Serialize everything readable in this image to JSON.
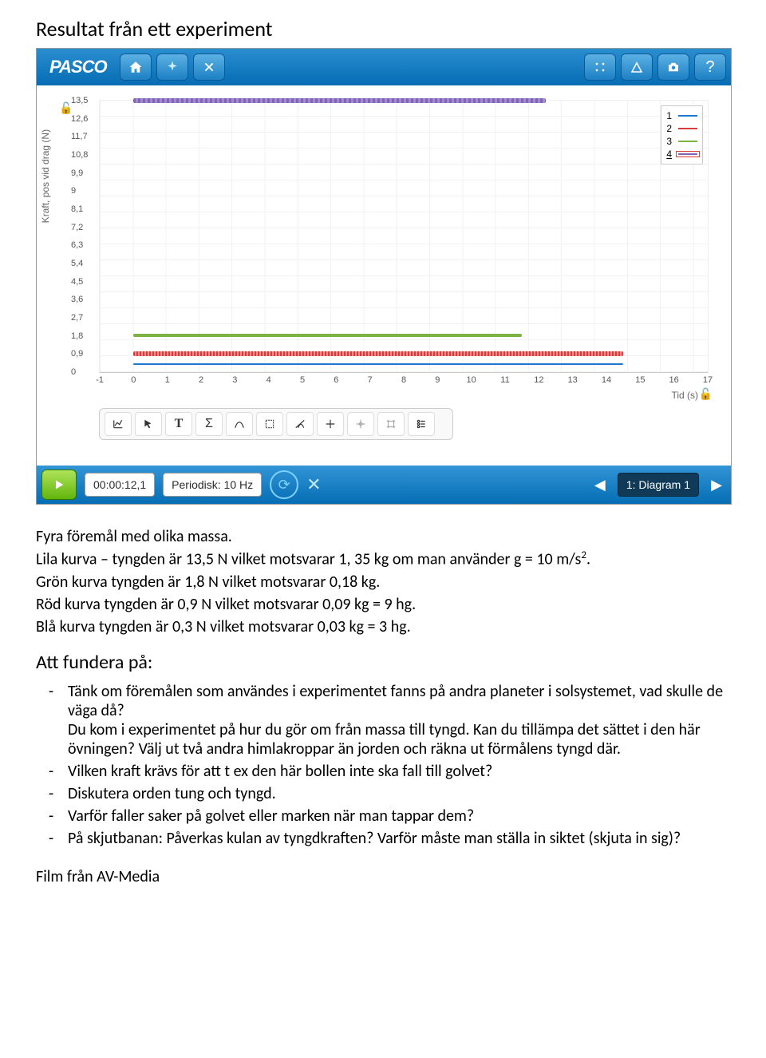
{
  "heading": "Resultat från ett experiment",
  "app": {
    "logo": "PASCO",
    "yaxis": "Kraft, pos vid drag (N)",
    "xaxis": "Tid (s)",
    "time": "00:00:12,1",
    "rate": "Periodisk: 10 Hz",
    "diagram": "1: Diagram 1",
    "legend": [
      "1",
      "2",
      "3",
      "4"
    ]
  },
  "chart_data": {
    "type": "line",
    "title": "",
    "xlabel": "Tid (s)",
    "ylabel": "Kraft, pos vid drag (N)",
    "xlim": [
      -1,
      17
    ],
    "ylim": [
      0,
      13.5
    ],
    "xticks": [
      -1,
      0,
      1,
      2,
      3,
      4,
      5,
      6,
      7,
      8,
      9,
      10,
      11,
      12,
      13,
      14,
      15,
      16,
      17
    ],
    "yticks": [
      0.0,
      0.9,
      1.8,
      2.7,
      3.6,
      4.5,
      5.4,
      6.3,
      7.2,
      8.1,
      9.0,
      9.9,
      10.8,
      11.7,
      12.6,
      13.5
    ],
    "series": [
      {
        "name": "1",
        "color": "blue",
        "yvalue": 0.3,
        "x_start": 0,
        "x_end": 14.5
      },
      {
        "name": "2",
        "color": "red",
        "yvalue": 0.9,
        "x_start": 0,
        "x_end": 14.5
      },
      {
        "name": "3",
        "color": "green",
        "yvalue": 1.8,
        "x_start": 0,
        "x_end": 11.5
      },
      {
        "name": "4",
        "color": "purple",
        "yvalue": 13.5,
        "x_start": 0,
        "x_end": 12.2
      }
    ]
  },
  "body": {
    "p1": "Fyra föremål med olika massa.",
    "p2a": "Lila kurva – tyngden är 13,5 N vilket motsvarar 1, 35 kg om man använder g = 10 m/s",
    "p2b_sup": "2",
    "p2c": ".",
    "p3": "Grön kurva tyngden är 1,8 N vilket motsvarar 0,18 kg.",
    "p4": "Röd kurva tyngden är 0,9 N vilket motsvarar 0,09 kg = 9 hg.",
    "p5": "Blå kurva tyngden är 0,3 N vilket motsvarar 0,03 kg = 3 hg.",
    "thinkTitle": "Att fundera på:",
    "q1a": "Tänk om föremålen som användes i experimentet fanns på andra planeter i solsystemet, vad skulle de väga då?",
    "q1b": "Du kom i experimentet på hur du gör om från massa till tyngd. Kan du tillämpa det sättet i den här övningen? Välj ut två andra himlakroppar än jorden och räkna ut förmålens tyngd där.",
    "q2": "Vilken kraft krävs för att t ex den här bollen inte ska fall till golvet?",
    "q3": "Diskutera orden tung och tyngd.",
    "q4": "Varför faller saker på golvet eller marken när man tappar dem?",
    "q5": "På skjutbanan: Påverkas kulan av tyngdkraften? Varför måste man ställa in siktet (skjuta in sig)?",
    "footer": "Film från AV-Media"
  }
}
